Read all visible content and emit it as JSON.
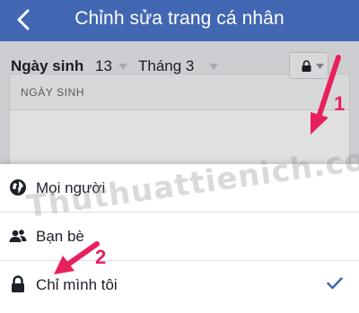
{
  "navbar": {
    "title": "Chỉnh sửa trang cá nhân"
  },
  "card": {
    "header": "NGÀY SINH",
    "dob_label": "Ngày sinh",
    "day": "13",
    "month": "Tháng 3"
  },
  "privacy_menu": {
    "items": [
      {
        "label": "Mọi người",
        "icon": "globe-icon"
      },
      {
        "label": "Bạn bè",
        "icon": "friends-icon"
      },
      {
        "label": "Chỉ mình tôi",
        "icon": "lock-icon",
        "selected": true
      }
    ]
  },
  "watermark": "Thuthuattienich.com",
  "annotations": {
    "step1": "1",
    "step2": "2"
  },
  "colors": {
    "navbar": "#4267b2",
    "arrow": "#e8205c",
    "check": "#4267b2"
  }
}
